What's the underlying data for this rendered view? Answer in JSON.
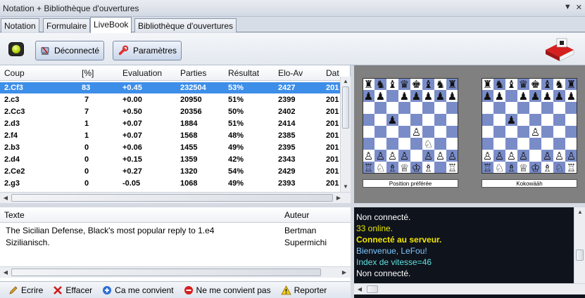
{
  "window": {
    "title": "Notation + Bibliothèque d'ouvertures"
  },
  "tabs": [
    {
      "label": "Notation"
    },
    {
      "label": "Formulaire"
    },
    {
      "label": "LiveBook"
    },
    {
      "label": "Bibliothèque d'ouvertures"
    }
  ],
  "toolbar": {
    "connect_label": "Déconnecté",
    "settings_label": "Paramètres"
  },
  "moves": {
    "headers": {
      "coup": "Coup",
      "pct": "[%]",
      "eval": "Evaluation",
      "parties": "Parties",
      "resultat": "Résultat",
      "elo": "Elo-Av",
      "date": "Dat"
    },
    "rows": [
      {
        "coup": "2.Cf3",
        "pct": "83",
        "eval": "+0.45",
        "parties": "232504",
        "resultat": "53%",
        "elo": "2427",
        "date": "201"
      },
      {
        "coup": "2.c3",
        "pct": "7",
        "eval": "+0.00",
        "parties": "20950",
        "resultat": "51%",
        "elo": "2399",
        "date": "201"
      },
      {
        "coup": "2.Cc3",
        "pct": "7",
        "eval": "+0.50",
        "parties": "20356",
        "resultat": "50%",
        "elo": "2402",
        "date": "201"
      },
      {
        "coup": "2.d3",
        "pct": "1",
        "eval": "+0.07",
        "parties": "1884",
        "resultat": "51%",
        "elo": "2414",
        "date": "201"
      },
      {
        "coup": "2.f4",
        "pct": "1",
        "eval": "+0.07",
        "parties": "1568",
        "resultat": "48%",
        "elo": "2385",
        "date": "201"
      },
      {
        "coup": "2.b3",
        "pct": "0",
        "eval": "+0.06",
        "parties": "1455",
        "resultat": "49%",
        "elo": "2395",
        "date": "201"
      },
      {
        "coup": "2.d4",
        "pct": "0",
        "eval": "+0.15",
        "parties": "1359",
        "resultat": "42%",
        "elo": "2343",
        "date": "201"
      },
      {
        "coup": "2.Ce2",
        "pct": "0",
        "eval": "+0.27",
        "parties": "1320",
        "resultat": "54%",
        "elo": "2429",
        "date": "201"
      },
      {
        "coup": "2.g3",
        "pct": "0",
        "eval": "-0.05",
        "parties": "1068",
        "resultat": "49%",
        "elo": "2393",
        "date": "201"
      }
    ]
  },
  "comments": {
    "headers": {
      "texte": "Texte",
      "auteur": "Auteur"
    },
    "rows": [
      {
        "texte": "The Sicilian Defense, Black's most popular reply to 1.e4",
        "auteur": "Bertman"
      },
      {
        "texte": "Sizilianisch.",
        "auteur": "Supermichi"
      }
    ]
  },
  "actions": {
    "ecrire": "Ecrire",
    "effacer": "Effacer",
    "convient": "Ca me convient",
    "ne_convient": "Ne me convient pas",
    "reporter": "Reporter"
  },
  "boards": {
    "left_caption": "Position préférée",
    "right_caption": "Kokowääh"
  },
  "console": [
    {
      "text": "Non connecté.",
      "color": "#ffffff",
      "bold": false
    },
    {
      "text": "33 online.",
      "color": "#e8e800",
      "bold": false
    },
    {
      "text": "Connecté au serveur.",
      "color": "#f2e600",
      "bold": true
    },
    {
      "text": "Bienvenue, LeFou!",
      "color": "#7fc8ff",
      "bold": false
    },
    {
      "text": "Index de vitesse=46",
      "color": "#5fe0e0",
      "bold": false
    },
    {
      "text": "Non connecté.",
      "color": "#ffffff",
      "bold": false
    }
  ],
  "colors": {
    "selection": "#3d8ee8",
    "board_dark": "#7a8cc8",
    "board_light": "#ffffff",
    "console_bg": "#0f131c"
  }
}
